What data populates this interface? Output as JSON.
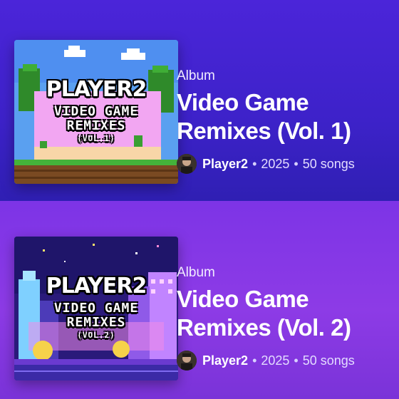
{
  "albums": [
    {
      "type": "Album",
      "title": "Video Game Remixes (Vol. 1)",
      "artist": "Player2",
      "year": "2025",
      "songs": "50 songs",
      "cover": {
        "logo": "PLAYER2",
        "line1": "VIDEO GAME",
        "line2": "REMIXES",
        "line3": "(VOL.1)"
      }
    },
    {
      "type": "Album",
      "title": "Video Game Remixes (Vol. 2)",
      "artist": "Player2",
      "year": "2025",
      "songs": "50 songs",
      "cover": {
        "logo": "PLAYER2",
        "line1": "VIDEO GAME",
        "line2": "REMIXES",
        "line3": "(VOL.2)"
      }
    }
  ],
  "separator": "•",
  "colors": {
    "panel1": "#3d22c9",
    "panel2": "#8a3ae6"
  }
}
